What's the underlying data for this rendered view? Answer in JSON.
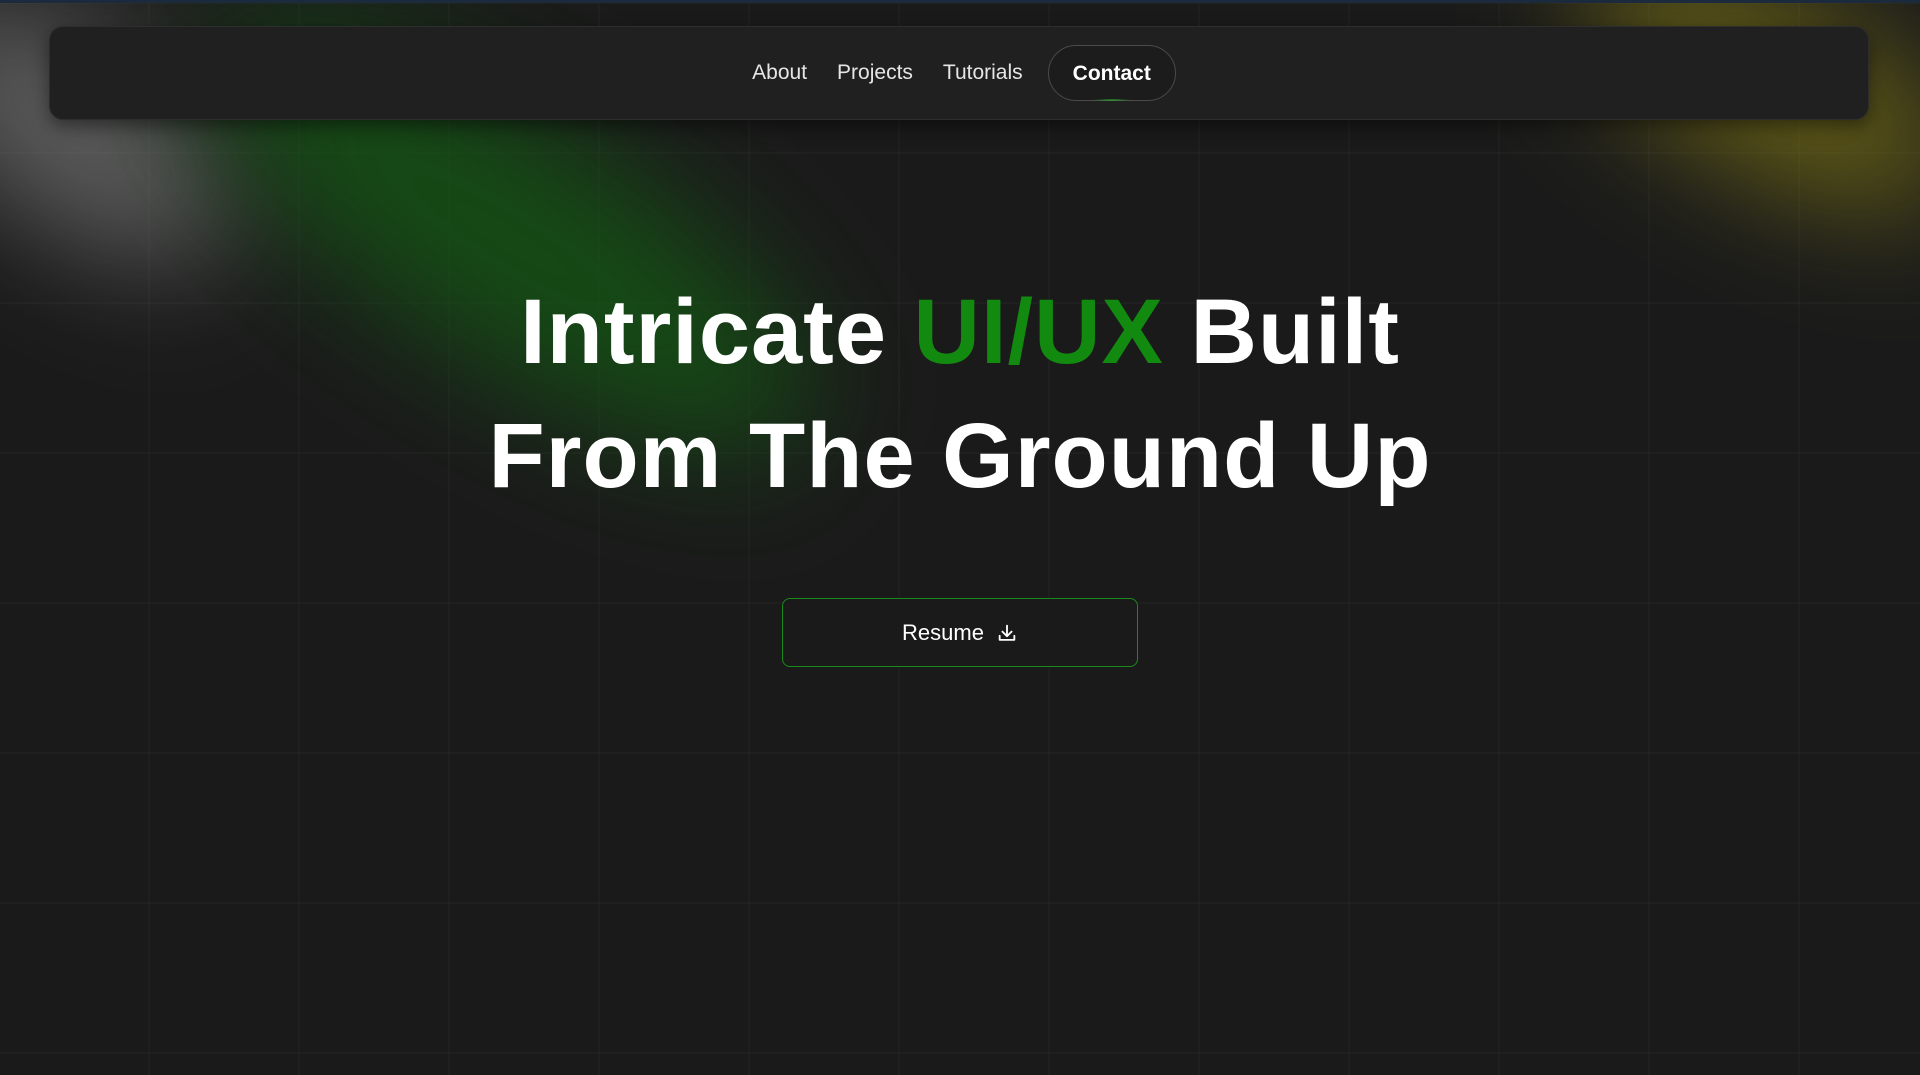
{
  "nav": {
    "items": [
      {
        "label": "About"
      },
      {
        "label": "Projects"
      },
      {
        "label": "Tutorials"
      }
    ],
    "contact_label": "Contact"
  },
  "hero": {
    "line1_pre": "Intricate ",
    "line1_accent": "UI/UX",
    "line1_post": " Built",
    "line2": "From The Ground Up"
  },
  "resume": {
    "label": "Resume",
    "icon": "download-icon"
  },
  "colors": {
    "background": "#1a1a1a",
    "accent": "#128a10",
    "button_border": "#1a8a1a"
  }
}
